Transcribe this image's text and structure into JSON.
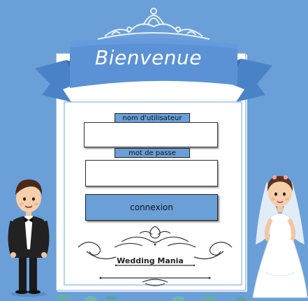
{
  "header": {
    "title": "Bienvenue"
  },
  "form": {
    "username_label": "nom d'utilisateur",
    "username_value": "",
    "password_label": "mot de passe",
    "password_value": "",
    "submit_label": "connexion"
  },
  "footer": {
    "brand": "Wedding Mania"
  },
  "colors": {
    "background": "#6b9fd8",
    "ribbon": "#5b92d6",
    "card": "#ffffff",
    "button": "#6b9fd8"
  },
  "icons": [
    "tiara-icon",
    "groom-illustration",
    "bride-illustration",
    "ornament-flourish"
  ]
}
